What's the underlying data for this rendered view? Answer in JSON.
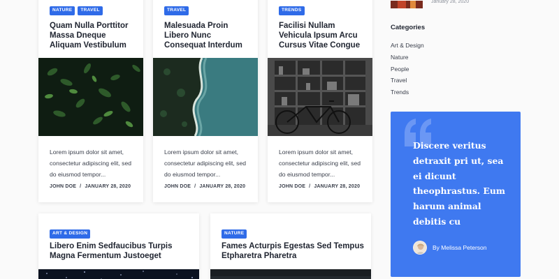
{
  "posts": [
    {
      "tags": [
        "Nature",
        "Travel"
      ],
      "title": "Quam Nulla Porttitor Massa Dneque Aliquam Vestibulum",
      "excerpt": "Lorem ipsum dolor sit amet, consectetur adipiscing elit, sed do eiusmod tempor...",
      "author": "JOHN DOE",
      "date": "JANUARY 28, 2020",
      "image": "leaves-photo"
    },
    {
      "tags": [
        "Travel"
      ],
      "title": "Malesuada Proin Libero Nunc Consequat Interdum",
      "excerpt": "Lorem ipsum dolor sit amet, consectetur adipiscing elit, sed do eiusmod tempor...",
      "author": "JOHN DOE",
      "date": "JANUARY 28, 2020",
      "image": "coast-aerial-photo"
    },
    {
      "tags": [
        "Trends"
      ],
      "title": "Facilisi Nullam Vehicula Ipsum Arcu Cursus Vitae Congue",
      "excerpt": "Lorem ipsum dolor sit amet, consectetur adipiscing elit, sed do eiusmod tempor...",
      "author": "JOHN DOE",
      "date": "JANUARY 28, 2020",
      "image": "bookshelf-bicycle-photo"
    },
    {
      "tags": [
        "Art & Design"
      ],
      "title": "Libero Enim Sedfaucibus Turpis Magna Fermentum Justoeget",
      "image": "starry-sky-photo"
    },
    {
      "tags": [
        "Nature"
      ],
      "title": "Fames Acturpis Egestas Sed Tempus Etpharetra Pharetra",
      "image": "dark-landscape-photo"
    }
  ],
  "sidebar": {
    "recent_date": "January 28, 2020",
    "categories_heading": "Categories",
    "categories": [
      "Art & Design",
      "Nature",
      "People",
      "Travel",
      "Trends"
    ],
    "quote": {
      "text": "Discere veritus detraxit pri ut, sea ei dicunt theophrastus. Eum harum animal debitis cu",
      "author": "By Melissa Peterson"
    }
  },
  "colors": {
    "accent": "#2f6be8",
    "quote_bg": "#3f79f0"
  }
}
